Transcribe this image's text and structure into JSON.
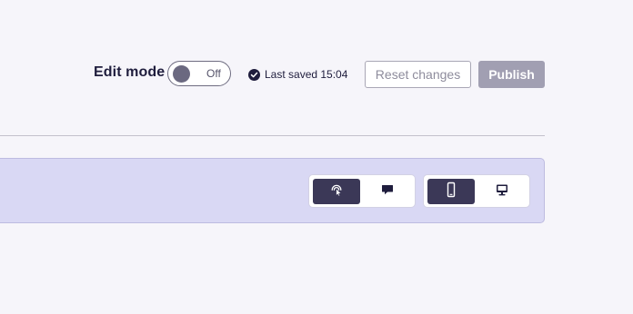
{
  "toolbar": {
    "edit_mode_label": "Edit mode",
    "toggle_state": "Off",
    "saved_status": "Last saved 15:04",
    "reset_label": "Reset changes",
    "publish_label": "Publish"
  },
  "view_controls": {
    "mode": {
      "options": [
        {
          "icon": "interact-pointer-icon",
          "active": true
        },
        {
          "icon": "comment-icon",
          "active": false
        }
      ]
    },
    "device": {
      "options": [
        {
          "icon": "mobile-icon",
          "active": true
        },
        {
          "icon": "desktop-icon",
          "active": false
        }
      ]
    }
  },
  "colors": {
    "background": "#f6f5fa",
    "panel": "#d9d8f4",
    "active_segment": "#3b3857",
    "primary_text": "#1f1d3d",
    "publish_disabled": "#a19fb2"
  }
}
